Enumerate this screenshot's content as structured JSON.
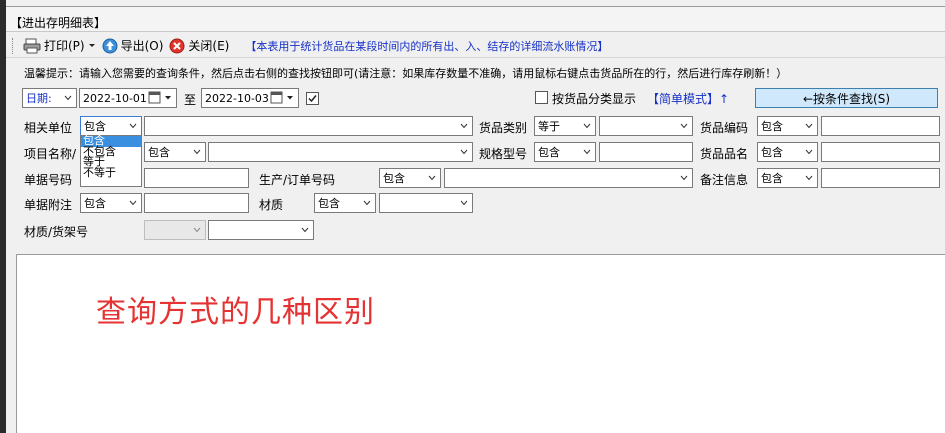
{
  "window": {
    "title": "【进出存明细表】"
  },
  "toolbar": {
    "print_label": "打印(P)",
    "export_label": "导出(O)",
    "close_label": "关闭(E)",
    "note": "【本表用于统计货品在某段时间内的所有出、入、结存的详细流水账情况】"
  },
  "hint": "温馨提示：请输入您需要的查询条件，然后点击右侧的查找按钮即可(请注意：如果库存数量不准确，请用鼠标右键点击货品所在的行，然后进行库存刷新！）",
  "date_row": {
    "date_label": "日期:",
    "start_date": "2022-10-01",
    "to_label": "至",
    "end_date": "2022-10-03",
    "category_display_label": "按货品分类显示",
    "simple_mode_label": "【简单模式】↑",
    "find_button_label": "←按条件查找(S)"
  },
  "filters": {
    "related_unit": {
      "label": "相关单位",
      "op": "包含"
    },
    "item_category": {
      "label": "货品类别",
      "op": "等于"
    },
    "item_code": {
      "label": "货品编码",
      "op": "包含"
    },
    "project_name": {
      "label": "项目名称/",
      "op": "包含"
    },
    "spec_model": {
      "label": "规格型号",
      "op": "包含"
    },
    "item_name": {
      "label": "货品品名",
      "op": "包含"
    },
    "doc_number": {
      "label": "单据号码"
    },
    "production_order": {
      "label": "生产/订单号码",
      "op": "包含"
    },
    "remark_info": {
      "label": "备注信息",
      "op": "包含"
    },
    "doc_note": {
      "label": "单据附注",
      "op": "包含"
    },
    "material": {
      "label": "材质",
      "op": "包含"
    },
    "material_shelf": {
      "label": "材质/货架号"
    }
  },
  "op_dropdown": {
    "options": [
      "包含",
      "不包含",
      "等于",
      "不等于"
    ],
    "selected_index": 0
  },
  "content": {
    "overlay_text": "查询方式的几种区别"
  },
  "colors": {
    "accent_blue": "#1630c8",
    "overlay_red": "#e53232",
    "selection": "#3a8fe0",
    "find_button": "#cfe8fb"
  }
}
